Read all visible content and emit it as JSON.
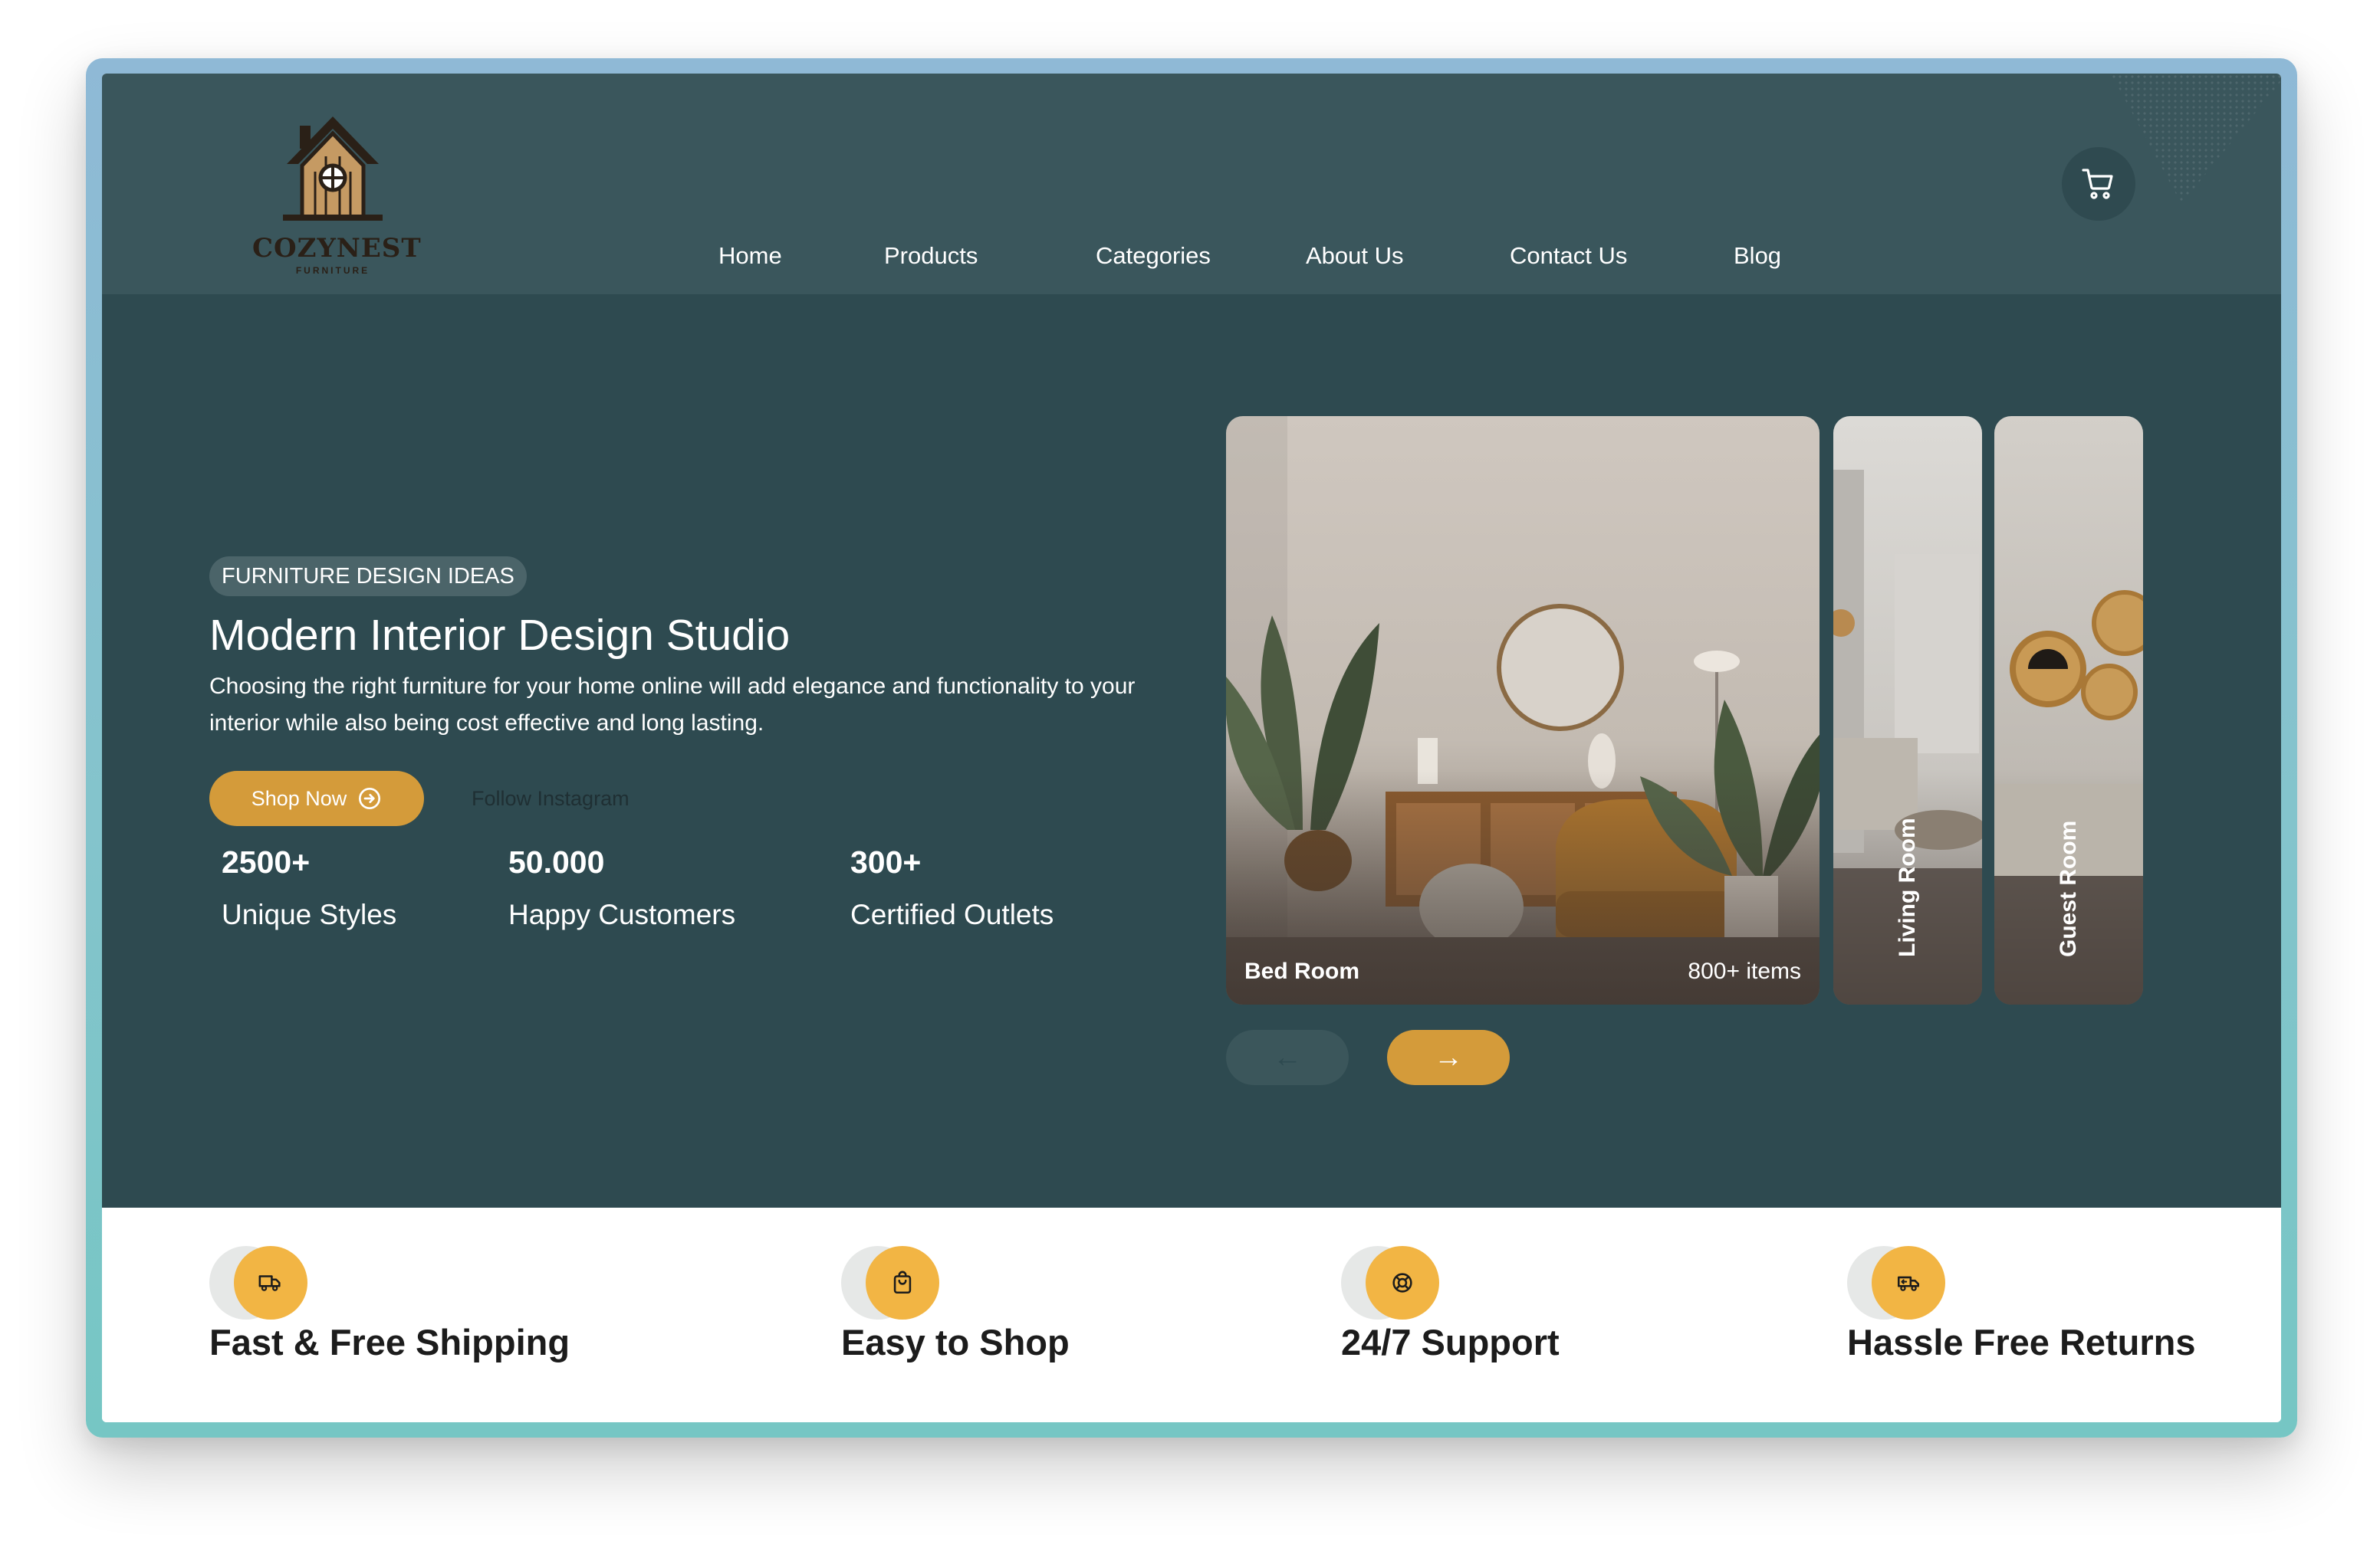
{
  "brand": {
    "name": "COZYNEST",
    "sub": "FURNITURE"
  },
  "nav": {
    "items": [
      {
        "label": "Home"
      },
      {
        "label": "Products"
      },
      {
        "label": "Categories"
      },
      {
        "label": "About Us"
      },
      {
        "label": "Contact Us"
      },
      {
        "label": "Blog"
      }
    ],
    "cart_icon": "cart-icon"
  },
  "hero": {
    "badge": "FURNITURE DESIGN IDEAS",
    "title": "Modern Interior Design Studio",
    "description": "Choosing the right furniture for your home online will add elegance and functionality to your interior while also being cost effective and long lasting.",
    "shop_button": "Shop Now",
    "follow_link": "Follow Instagram",
    "stats": [
      {
        "value": "2500+",
        "label": "Unique Styles"
      },
      {
        "value": "50.000",
        "label": "Happy Customers"
      },
      {
        "value": "300+",
        "label": "Certified Outlets"
      }
    ]
  },
  "carousel": {
    "cards": [
      {
        "label": "Bed Room",
        "count": "800+ items"
      },
      {
        "label": "Living Room"
      },
      {
        "label": "Guest Room"
      }
    ],
    "prev_arrow": "←",
    "next_arrow": "→"
  },
  "features": [
    {
      "title": "Fast & Free Shipping",
      "icon": "truck-icon"
    },
    {
      "title": "Easy to Shop",
      "icon": "shopping-bag-icon"
    },
    {
      "title": "24/7 Support",
      "icon": "lifebuoy-icon"
    },
    {
      "title": "Hassle Free Returns",
      "icon": "return-truck-icon"
    }
  ],
  "colors": {
    "header_bg": "#3a565c",
    "hero_bg": "#2e4a50",
    "accent": "#d49b3a",
    "feature_icon": "#f2b544"
  }
}
